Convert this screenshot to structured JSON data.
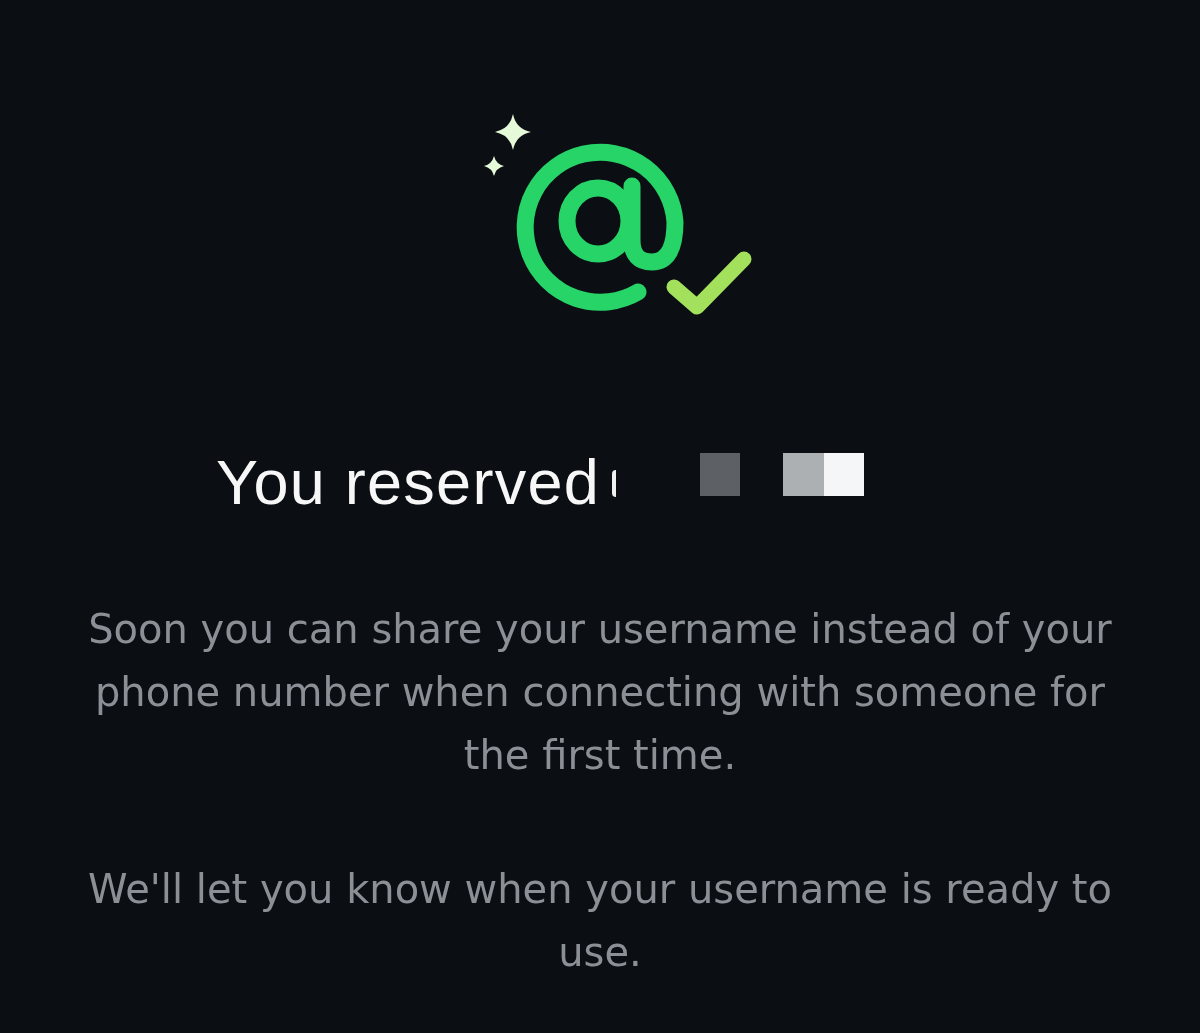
{
  "title": "You reserved",
  "username": {
    "redacted": true
  },
  "paragraphs": [
    "Soon you can share your username instead of your phone number when connecting with someone for the first time.",
    "We'll let you know when your username is ready to use."
  ]
}
